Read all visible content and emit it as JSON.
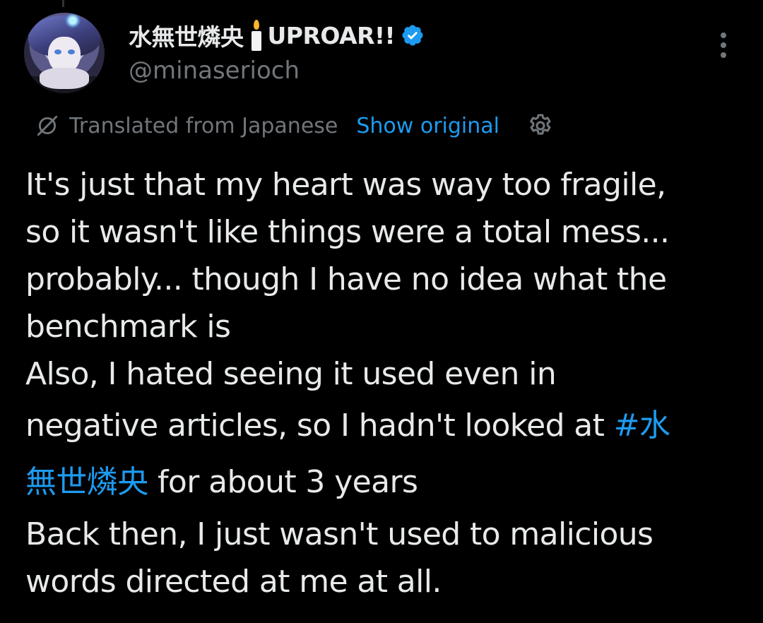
{
  "author": {
    "display_name": "水無世燐央",
    "display_name_suffix": "UPROAR!!",
    "handle": "@minaserioch",
    "verified": true,
    "emoji": "candle-icon"
  },
  "translation": {
    "label": "Translated from Japanese",
    "show_original_label": "Show original"
  },
  "tweet": {
    "line1": "It's just that my heart was way too fragile,",
    "line2": "so it wasn't like things were a total mess...",
    "line3": "probably... though I have no idea what the",
    "line4": "benchmark is",
    "line5": "Also, I hated seeing it used even in",
    "line6_text": "negative articles, so I hadn't looked at ",
    "line6_hashtag": "#水",
    "line7_hashtag": "無世燐央",
    "line7_text": " for about 3 years",
    "line8": "Back then, I just wasn't used to malicious",
    "line9": "words directed at me at all."
  },
  "colors": {
    "background": "#000000",
    "text": "#e7e9ea",
    "secondary": "#71767b",
    "accent": "#1d9bf0"
  }
}
